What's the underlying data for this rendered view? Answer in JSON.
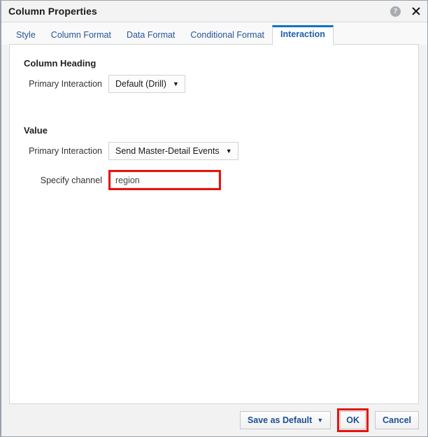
{
  "dialog": {
    "title": "Column Properties",
    "help_icon": "help-circle-icon",
    "close_icon": "close-icon"
  },
  "tabs": [
    {
      "label": "Style",
      "active": false
    },
    {
      "label": "Column Format",
      "active": false
    },
    {
      "label": "Data Format",
      "active": false
    },
    {
      "label": "Conditional Format",
      "active": false
    },
    {
      "label": "Interaction",
      "active": true
    }
  ],
  "sections": [
    {
      "heading": "Column Heading",
      "fields": [
        {
          "label": "Primary Interaction",
          "type": "select",
          "value": "Default (Drill)",
          "caret": "▼"
        }
      ]
    },
    {
      "heading": "Value",
      "fields": [
        {
          "label": "Primary Interaction",
          "type": "select",
          "value": "Send Master-Detail Events",
          "caret": "▼"
        },
        {
          "label": "Specify channel",
          "type": "text",
          "value": "region",
          "placeholder": ""
        }
      ]
    }
  ],
  "footer": {
    "save_as_default_label": "Save as Default",
    "save_as_default_caret": "▼",
    "ok_label": "OK",
    "cancel_label": "Cancel"
  },
  "colors": {
    "accent_blue": "#1173c4",
    "link_blue": "#25569c",
    "highlight_red": "#e8130f",
    "panel_bg": "#ffffff",
    "dialog_bg": "#f2f2f2"
  }
}
